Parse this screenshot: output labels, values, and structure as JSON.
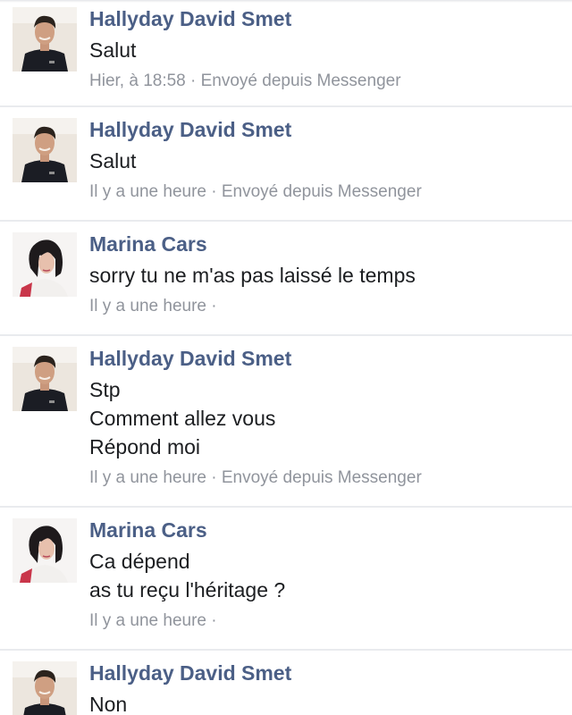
{
  "messages": [
    {
      "avatar": "man-portrait-avatar",
      "sender": "Hallyday David Smet",
      "lines": [
        "Salut"
      ],
      "meta": "Hier, à 18:58 · Envoyé depuis Messenger"
    },
    {
      "avatar": "man-portrait-avatar",
      "sender": "Hallyday David Smet",
      "lines": [
        "Salut"
      ],
      "meta": "Il y a une heure · Envoyé depuis Messenger"
    },
    {
      "avatar": "woman-portrait-avatar",
      "sender": "Marina Cars",
      "lines": [
        "sorry tu ne m'as pas laissé le temps"
      ],
      "meta": "Il y a une heure ·"
    },
    {
      "avatar": "man-portrait-avatar",
      "sender": "Hallyday David Smet",
      "lines": [
        "Stp",
        "Comment allez vous",
        "Répond moi"
      ],
      "meta": "Il y a une heure · Envoyé depuis Messenger"
    },
    {
      "avatar": "woman-portrait-avatar",
      "sender": "Marina Cars",
      "lines": [
        "Ca dépend",
        "as tu reçu l'héritage ?"
      ],
      "meta": "Il y a une heure ·"
    },
    {
      "avatar": "man-portrait-avatar",
      "sender": "Hallyday David Smet",
      "lines": [
        "Non"
      ],
      "meta": ""
    }
  ],
  "colors": {
    "sender": "#4b5f86",
    "text": "#1c1e21",
    "meta": "#90949c",
    "divider": "#e9ebee"
  }
}
